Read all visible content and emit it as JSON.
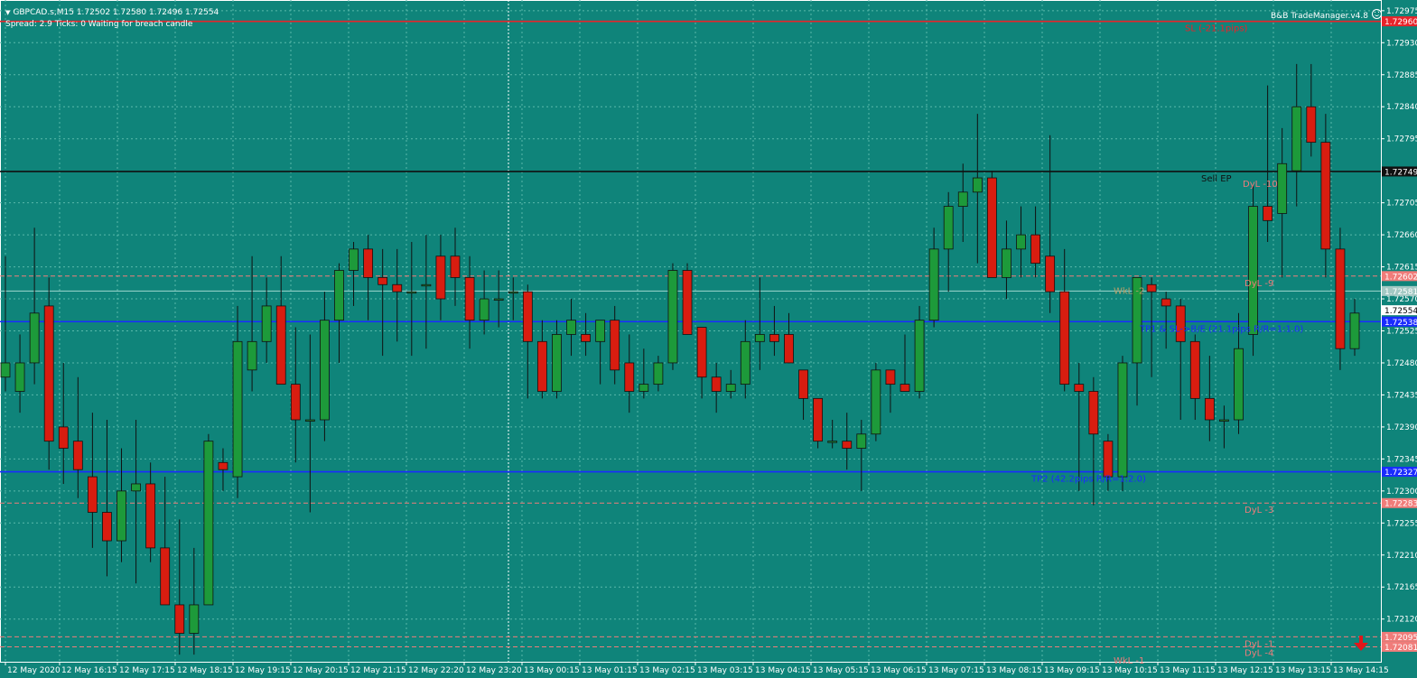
{
  "header": {
    "menu_glyph": "▼",
    "symbol_line": "GBPCAD.s,M15  1.72502 1.72580 1.72496 1.72554",
    "status_line": "Spread: 2.9  Ticks: 0  Waiting for breach candle",
    "plugin_label": "B&B TradeManager.v4.8",
    "plugin_icon": "smiley-icon"
  },
  "colors": {
    "background": "#0f847a",
    "grid": "#5ab9ab",
    "bull": "#1d9a3a",
    "bear": "#d81d10",
    "sl": "#e8232a",
    "entry": "#101010",
    "tp": "#1a2bff",
    "dyl": "#f07c7a"
  },
  "chart_data": {
    "type": "candlestick",
    "symbol": "GBPCAD.s",
    "timeframe": "M15",
    "ylim": [
      1.7206,
      1.7299
    ],
    "y_ticks": [
      "1.72975",
      "1.72930",
      "1.72885",
      "1.72840",
      "1.72795",
      "1.72705",
      "1.72660",
      "1.72615",
      "1.72570",
      "1.72525",
      "1.72480",
      "1.72435",
      "1.72390",
      "1.72345",
      "1.72300",
      "1.72255",
      "1.72210",
      "1.72165",
      "1.72120"
    ],
    "x_ticks": [
      "12 May 2020",
      "12 May 16:15",
      "12 May 17:15",
      "12 May 18:15",
      "12 May 19:15",
      "12 May 20:15",
      "12 May 21:15",
      "12 May 22:20",
      "12 May 23:20",
      "13 May 00:15",
      "13 May 01:15",
      "13 May 02:15",
      "13 May 03:15",
      "13 May 04:15",
      "13 May 05:15",
      "13 May 06:15",
      "13 May 07:15",
      "13 May 08:15",
      "13 May 09:15",
      "13 May 10:15",
      "13 May 11:15",
      "13 May 12:15",
      "13 May 13:15",
      "13 May 14:15"
    ],
    "candles": [
      [
        1.7246,
        1.7263,
        1.7244,
        1.7248
      ],
      [
        1.7244,
        1.7252,
        1.7241,
        1.7248
      ],
      [
        1.7248,
        1.7267,
        1.7245,
        1.7255
      ],
      [
        1.7256,
        1.726,
        1.7233,
        1.7237
      ],
      [
        1.7239,
        1.7248,
        1.7231,
        1.7236
      ],
      [
        1.7237,
        1.7246,
        1.7229,
        1.7233
      ],
      [
        1.7232,
        1.7241,
        1.7222,
        1.7227
      ],
      [
        1.7227,
        1.724,
        1.7218,
        1.7223
      ],
      [
        1.7223,
        1.7236,
        1.722,
        1.723
      ],
      [
        1.723,
        1.724,
        1.7217,
        1.7231
      ],
      [
        1.7231,
        1.7234,
        1.722,
        1.7222
      ],
      [
        1.7222,
        1.7232,
        1.7217,
        1.7214
      ],
      [
        1.7214,
        1.7226,
        1.7207,
        1.721
      ],
      [
        1.721,
        1.7222,
        1.7207,
        1.7214
      ],
      [
        1.7214,
        1.7238,
        1.7214,
        1.7237
      ],
      [
        1.7234,
        1.7236,
        1.723,
        1.7233
      ],
      [
        1.7232,
        1.7256,
        1.7229,
        1.7251
      ],
      [
        1.7247,
        1.7263,
        1.7244,
        1.7251
      ],
      [
        1.7251,
        1.726,
        1.7248,
        1.7256
      ],
      [
        1.7256,
        1.7263,
        1.7245,
        1.7245
      ],
      [
        1.7245,
        1.7253,
        1.7234,
        1.724
      ],
      [
        1.724,
        1.7252,
        1.7227,
        1.724
      ],
      [
        1.724,
        1.7258,
        1.7237,
        1.7254
      ],
      [
        1.7254,
        1.7262,
        1.7248,
        1.7261
      ],
      [
        1.7261,
        1.7265,
        1.7256,
        1.7264
      ],
      [
        1.7264,
        1.7266,
        1.7254,
        1.726
      ],
      [
        1.726,
        1.7264,
        1.7249,
        1.7259
      ],
      [
        1.7259,
        1.7264,
        1.7251,
        1.7258
      ],
      [
        1.7258,
        1.7265,
        1.7249,
        1.7258
      ],
      [
        1.7259,
        1.7266,
        1.725,
        1.7259
      ],
      [
        1.7263,
        1.7266,
        1.7254,
        1.7257
      ],
      [
        1.7263,
        1.7267,
        1.7256,
        1.726
      ],
      [
        1.726,
        1.7263,
        1.725,
        1.7254
      ],
      [
        1.7254,
        1.7261,
        1.7252,
        1.7257
      ],
      [
        1.7257,
        1.7261,
        1.7253,
        1.7257
      ],
      [
        1.7258,
        1.726,
        1.7254,
        1.7258
      ],
      [
        1.7258,
        1.7259,
        1.7243,
        1.7251
      ],
      [
        1.7251,
        1.7254,
        1.7243,
        1.7244
      ],
      [
        1.7244,
        1.7254,
        1.7243,
        1.7252
      ],
      [
        1.7252,
        1.7257,
        1.7249,
        1.7254
      ],
      [
        1.7252,
        1.7255,
        1.7249,
        1.7251
      ],
      [
        1.7251,
        1.7254,
        1.7245,
        1.7254
      ],
      [
        1.7254,
        1.7256,
        1.7245,
        1.7247
      ],
      [
        1.7248,
        1.7252,
        1.7241,
        1.7244
      ],
      [
        1.7244,
        1.725,
        1.7243,
        1.7245
      ],
      [
        1.7245,
        1.7249,
        1.7244,
        1.7248
      ],
      [
        1.7248,
        1.7262,
        1.7247,
        1.7261
      ],
      [
        1.7261,
        1.7262,
        1.7252,
        1.7252
      ],
      [
        1.7253,
        1.7253,
        1.7243,
        1.7246
      ],
      [
        1.7246,
        1.7248,
        1.7241,
        1.7244
      ],
      [
        1.7244,
        1.7247,
        1.7243,
        1.7245
      ],
      [
        1.7245,
        1.7254,
        1.7243,
        1.7251
      ],
      [
        1.7251,
        1.726,
        1.7247,
        1.7252
      ],
      [
        1.7252,
        1.7256,
        1.7249,
        1.7251
      ],
      [
        1.7252,
        1.7255,
        1.7248,
        1.7248
      ],
      [
        1.7247,
        1.7247,
        1.724,
        1.7243
      ],
      [
        1.7243,
        1.7243,
        1.7236,
        1.7237
      ],
      [
        1.7237,
        1.724,
        1.7236,
        1.7237
      ],
      [
        1.7237,
        1.7241,
        1.7233,
        1.7236
      ],
      [
        1.7236,
        1.724,
        1.723,
        1.7238
      ],
      [
        1.7238,
        1.7248,
        1.7237,
        1.7247
      ],
      [
        1.7247,
        1.7247,
        1.7241,
        1.7245
      ],
      [
        1.7245,
        1.7252,
        1.7244,
        1.7244
      ],
      [
        1.7244,
        1.7256,
        1.7243,
        1.7254
      ],
      [
        1.7254,
        1.7267,
        1.7253,
        1.7264
      ],
      [
        1.7264,
        1.7272,
        1.7258,
        1.727
      ],
      [
        1.727,
        1.7276,
        1.7265,
        1.7272
      ],
      [
        1.7272,
        1.7283,
        1.7262,
        1.7274
      ],
      [
        1.7274,
        1.7275,
        1.7261,
        1.726
      ],
      [
        1.726,
        1.7268,
        1.7257,
        1.7264
      ],
      [
        1.7264,
        1.727,
        1.726,
        1.7266
      ],
      [
        1.7266,
        1.727,
        1.726,
        1.7262
      ],
      [
        1.7263,
        1.728,
        1.7255,
        1.7258
      ],
      [
        1.7258,
        1.7264,
        1.7244,
        1.7245
      ],
      [
        1.7245,
        1.7248,
        1.723,
        1.7244
      ],
      [
        1.7244,
        1.7246,
        1.7228,
        1.7238
      ],
      [
        1.7237,
        1.7238,
        1.723,
        1.7232
      ],
      [
        1.7232,
        1.7249,
        1.723,
        1.7248
      ],
      [
        1.7248,
        1.726,
        1.7242,
        1.726
      ],
      [
        1.7259,
        1.726,
        1.7246,
        1.7258
      ],
      [
        1.7257,
        1.7258,
        1.725,
        1.7256
      ],
      [
        1.7256,
        1.7257,
        1.724,
        1.7251
      ],
      [
        1.7251,
        1.7252,
        1.724,
        1.7243
      ],
      [
        1.7243,
        1.7249,
        1.7237,
        1.724
      ],
      [
        1.724,
        1.7242,
        1.7236,
        1.724
      ],
      [
        1.724,
        1.7255,
        1.7238,
        1.725
      ],
      [
        1.7252,
        1.7273,
        1.7249,
        1.727
      ],
      [
        1.727,
        1.7287,
        1.7265,
        1.7268
      ],
      [
        1.7269,
        1.7281,
        1.726,
        1.7276
      ],
      [
        1.7275,
        1.729,
        1.727,
        1.7284
      ],
      [
        1.7284,
        1.729,
        1.7277,
        1.7279
      ],
      [
        1.7279,
        1.7283,
        1.726,
        1.7264
      ],
      [
        1.7264,
        1.7267,
        1.7247,
        1.725
      ],
      [
        1.725,
        1.7257,
        1.7249,
        1.7255
      ]
    ],
    "price_lines": [
      {
        "key": "sl",
        "price": 1.7296,
        "label": "SL (-21.1pips)",
        "style": "solid"
      },
      {
        "key": "entry",
        "price": 1.72749,
        "label": "Sell EP",
        "style": "solid"
      },
      {
        "key": "tp1",
        "price": 1.72538,
        "label": "TP1 & SL->B/E (21.1pips R/R=1:1.0)",
        "style": "solid"
      },
      {
        "key": "tp2",
        "price": 1.72327,
        "label": "TP2 (42.2pips R/R=1:2.0)",
        "style": "solid"
      },
      {
        "key": "dyl9",
        "price": 1.72602,
        "label": "DyL -9",
        "style": "dash"
      },
      {
        "key": "dyl3",
        "price": 1.72283,
        "label": "DyL -3",
        "style": "dash"
      },
      {
        "key": "dyl1",
        "price": 1.72095,
        "label": "DyL -1",
        "style": "dash"
      },
      {
        "key": "dyl4",
        "price": 1.72081,
        "label": "DyL -4",
        "style": "dash"
      },
      {
        "key": "gray",
        "price": 1.72581,
        "label": "",
        "style": "solid"
      }
    ],
    "extra_labels": [
      {
        "text": "DyL -10",
        "price": 1.7274
      },
      {
        "text": "WkL -2",
        "price": 1.7259
      },
      {
        "text": "WkL -1",
        "price": 1.7207
      }
    ],
    "price_tags": [
      {
        "text": "1.72960",
        "price": 1.7296,
        "bg": "#e8232a",
        "fg": "#ffffff"
      },
      {
        "text": "1.72749",
        "price": 1.72749,
        "bg": "#111111",
        "fg": "#ffffff"
      },
      {
        "text": "1.72602",
        "price": 1.72602,
        "bg": "#f07c7a",
        "fg": "#ffffff"
      },
      {
        "text": "1.72581",
        "price": 1.72581,
        "bg": "#a3c9c4",
        "fg": "#ffffff"
      },
      {
        "text": "1.72554",
        "price": 1.72554,
        "bg": "#ffffff",
        "fg": "#000000"
      },
      {
        "text": "1.72538",
        "price": 1.72538,
        "bg": "#1a2bff",
        "fg": "#ffffff"
      },
      {
        "text": "1.72327",
        "price": 1.72327,
        "bg": "#1a2bff",
        "fg": "#ffffff"
      },
      {
        "text": "1.72283",
        "price": 1.72283,
        "bg": "#f07c7a",
        "fg": "#ffffff"
      },
      {
        "text": "1.72095",
        "price": 1.72095,
        "bg": "#f07c7a",
        "fg": "#ffffff"
      },
      {
        "text": "1.72081",
        "price": 1.72081,
        "bg": "#f07c7a",
        "fg": "#ffffff"
      }
    ],
    "crosshair_candle_index": 35,
    "grid": true,
    "sell_arrow_icon": "red-down-arrow-icon"
  }
}
